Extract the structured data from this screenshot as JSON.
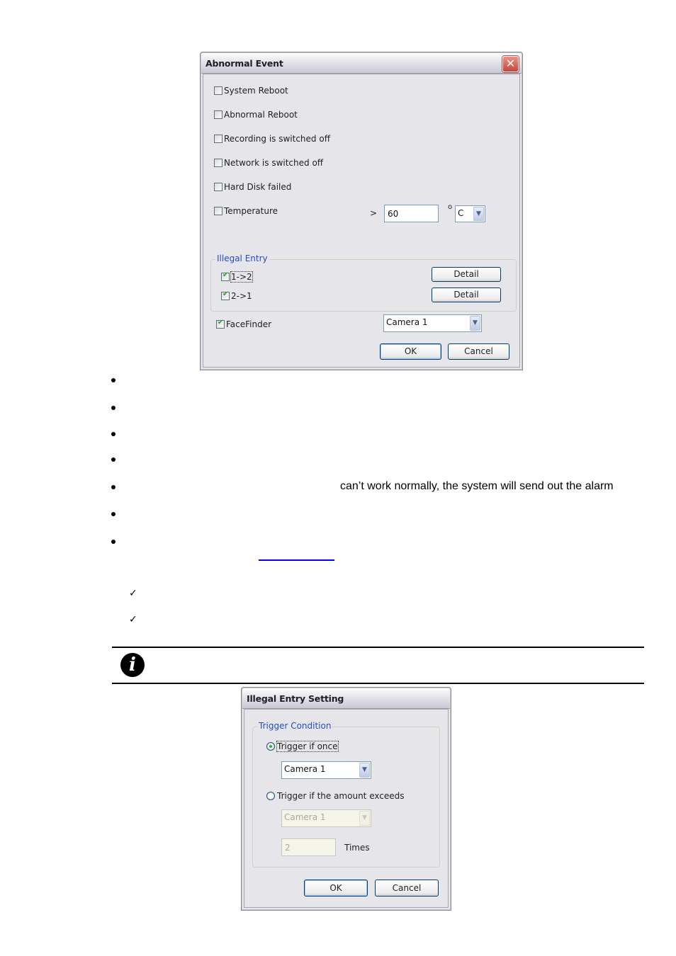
{
  "abnormal_event_dialog": {
    "title": "Abnormal Event",
    "close_icon": "close-x-icon",
    "options": [
      {
        "label": "System Reboot",
        "checked": false
      },
      {
        "label": "Abnormal Reboot",
        "checked": false
      },
      {
        "label": "Recording is switched off",
        "checked": false
      },
      {
        "label": "Network is switched off",
        "checked": false
      },
      {
        "label": "Hard Disk failed",
        "checked": false
      },
      {
        "label": "Temperature",
        "checked": false
      }
    ],
    "temperature": {
      "operator": ">",
      "value": "60",
      "degree_symbol": "o",
      "unit": "C"
    },
    "illegal_entry": {
      "legend": "Illegal Entry",
      "items": [
        {
          "label": "1->2",
          "checked": true,
          "detail_label": "Detail"
        },
        {
          "label": "2->1",
          "checked": true,
          "detail_label": "Detail"
        }
      ]
    },
    "facefinder": {
      "label": "FaceFinder",
      "checked": true,
      "camera": "Camera 1"
    },
    "ok_label": "OK",
    "cancel_label": "Cancel"
  },
  "document": {
    "bullet_count": 7,
    "bullet5_text": "can’t work normally, the system will send out the alarm",
    "checkmark_glyph": "✓",
    "info_icon_glyph": "i"
  },
  "illegal_entry_dialog": {
    "title": "Illegal Entry Setting",
    "group_legend": "Trigger Condition",
    "option_once": {
      "label": "Trigger if once",
      "selected": true,
      "camera": "Camera 1"
    },
    "option_amount": {
      "label": "Trigger if the amount exceeds",
      "selected": false,
      "camera": "Camera 1",
      "times_value": "2",
      "times_label": "Times"
    },
    "ok_label": "OK",
    "cancel_label": "Cancel"
  }
}
